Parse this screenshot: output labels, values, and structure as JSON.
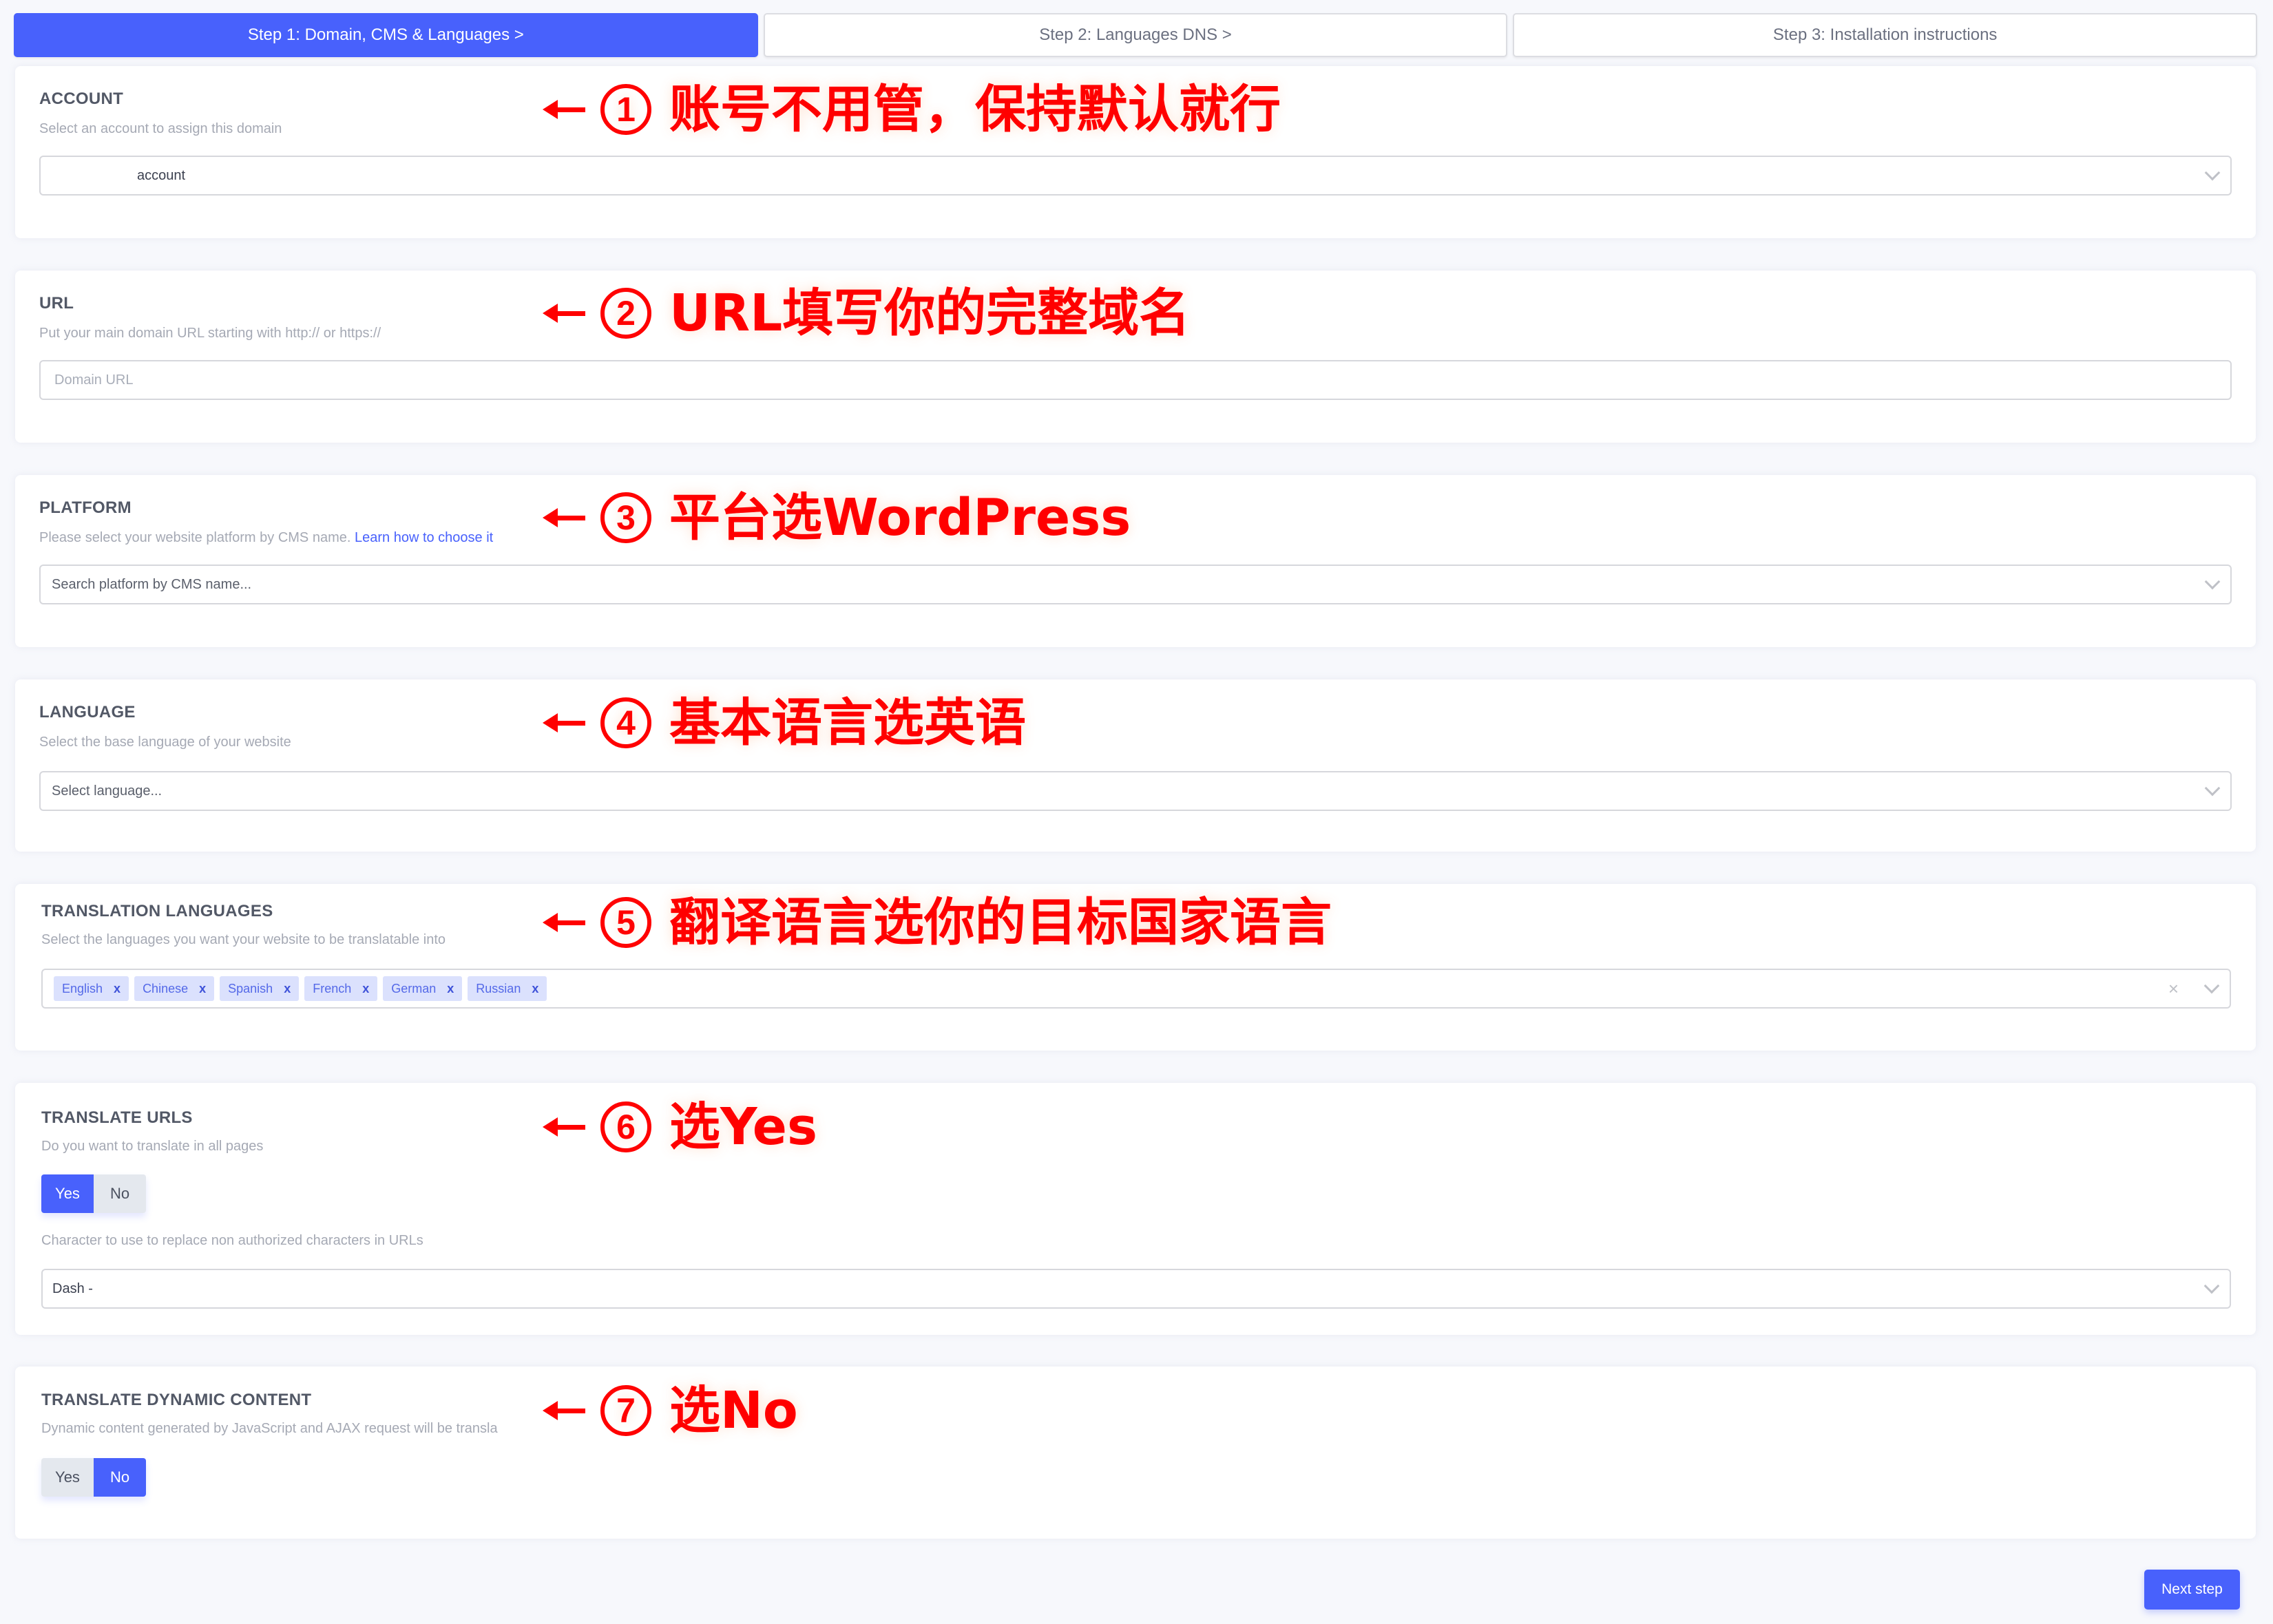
{
  "steps": [
    {
      "label": "Step 1: Domain, CMS & Languages  >",
      "active": true
    },
    {
      "label": "Step 2: Languages DNS  >",
      "active": false
    },
    {
      "label": "Step 3: Installation instructions",
      "active": false
    }
  ],
  "account": {
    "title": "ACCOUNT",
    "description": "Select an account to assign this domain",
    "value": "account"
  },
  "url": {
    "title": "URL",
    "description": "Put your main domain URL starting with http:// or https://",
    "placeholder": "Domain URL"
  },
  "platform": {
    "title": "PLATFORM",
    "description": "Please select your website platform by CMS name.",
    "link": "Learn how to choose it",
    "placeholder": "Search platform by CMS name..."
  },
  "language": {
    "title": "LANGUAGE",
    "description": "Select the base language of your website",
    "placeholder": "Select language..."
  },
  "translation_languages": {
    "title": "TRANSLATION LANGUAGES",
    "description": "Select the languages you want your website to be translatable into",
    "tags": [
      "English",
      "Chinese",
      "Spanish",
      "French",
      "German",
      "Russian"
    ],
    "remove_glyph": "x",
    "clear_glyph": "×"
  },
  "translate_urls": {
    "title": "TRANSLATE URLS",
    "description": "Do you want to translate in all pages",
    "options": [
      "Yes",
      "No"
    ],
    "selected": "Yes",
    "char_description": "Character to use to replace non authorized characters in URLs",
    "char_value": "Dash -"
  },
  "translate_dynamic": {
    "title": "TRANSLATE DYNAMIC CONTENT",
    "description": "Dynamic content generated by JavaScript and AJAX request will be transla",
    "options": [
      "Yes",
      "No"
    ],
    "selected": "No"
  },
  "annotations": [
    {
      "num": "1",
      "text": "账号不用管，保持默认就行"
    },
    {
      "num": "2",
      "text": "URL填写你的完整域名"
    },
    {
      "num": "3",
      "text": "平台选WordPress"
    },
    {
      "num": "4",
      "text": "基本语言选英语"
    },
    {
      "num": "5",
      "text": "翻译语言选你的目标国家语言"
    },
    {
      "num": "6",
      "text": "选Yes"
    },
    {
      "num": "7",
      "text": "选No"
    }
  ],
  "next_button": "Next step",
  "colors": {
    "accent": "#4861fc",
    "annotation": "#ff0000",
    "tag_bg": "#dbe1fd",
    "page_bg": "#f7f8fc"
  }
}
